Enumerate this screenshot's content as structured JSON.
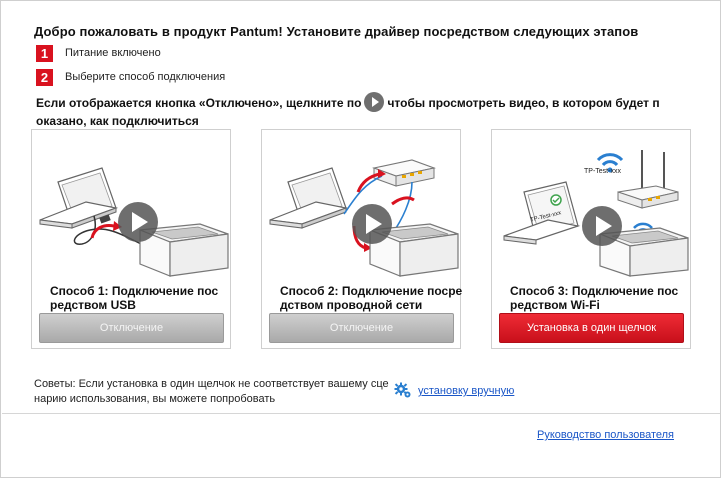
{
  "header": {
    "title": "Добро пожаловать в продукт Pantum! Установите драйвер посредством следующих этапов"
  },
  "steps": [
    {
      "number": "1",
      "text": "Питание включено"
    },
    {
      "number": "2",
      "text": "Выберите способ подключения"
    }
  ],
  "instruction": {
    "part1": "Если отображается кнопка «Отключено», щелкните по",
    "part2": "чтобы просмотреть видео, в котором будет п",
    "line2": "оказано, как подключиться"
  },
  "cards": [
    {
      "label_line1": "Способ 1: Подключение пос",
      "label_line2": "редством USB",
      "button": "Отключение",
      "button_state": "disabled",
      "icon": "usb-connection-illustration"
    },
    {
      "label_line1": "Способ 2: Подключение посре",
      "label_line2": "дством проводной сети",
      "button": "Отключение",
      "button_state": "disabled",
      "icon": "wired-network-illustration"
    },
    {
      "label_line1": "Способ 3: Подключение пос",
      "label_line2": "редством Wi-Fi",
      "button": "Установка в один щелчок",
      "button_state": "enabled",
      "icon": "wifi-illustration",
      "ssid": "TP-Test-xxx"
    }
  ],
  "tips": {
    "line1": "Советы: Если установка в один щелчок не соответствует вашему сце",
    "line2": "нарию использования, вы можете попробовать",
    "link": "установку вручную"
  },
  "footer": {
    "guide_link": "Руководство пользователя"
  },
  "colors": {
    "accent_red": "#d9121f",
    "button_gray": "#b8b8b8",
    "link_blue": "#1a56c7"
  }
}
